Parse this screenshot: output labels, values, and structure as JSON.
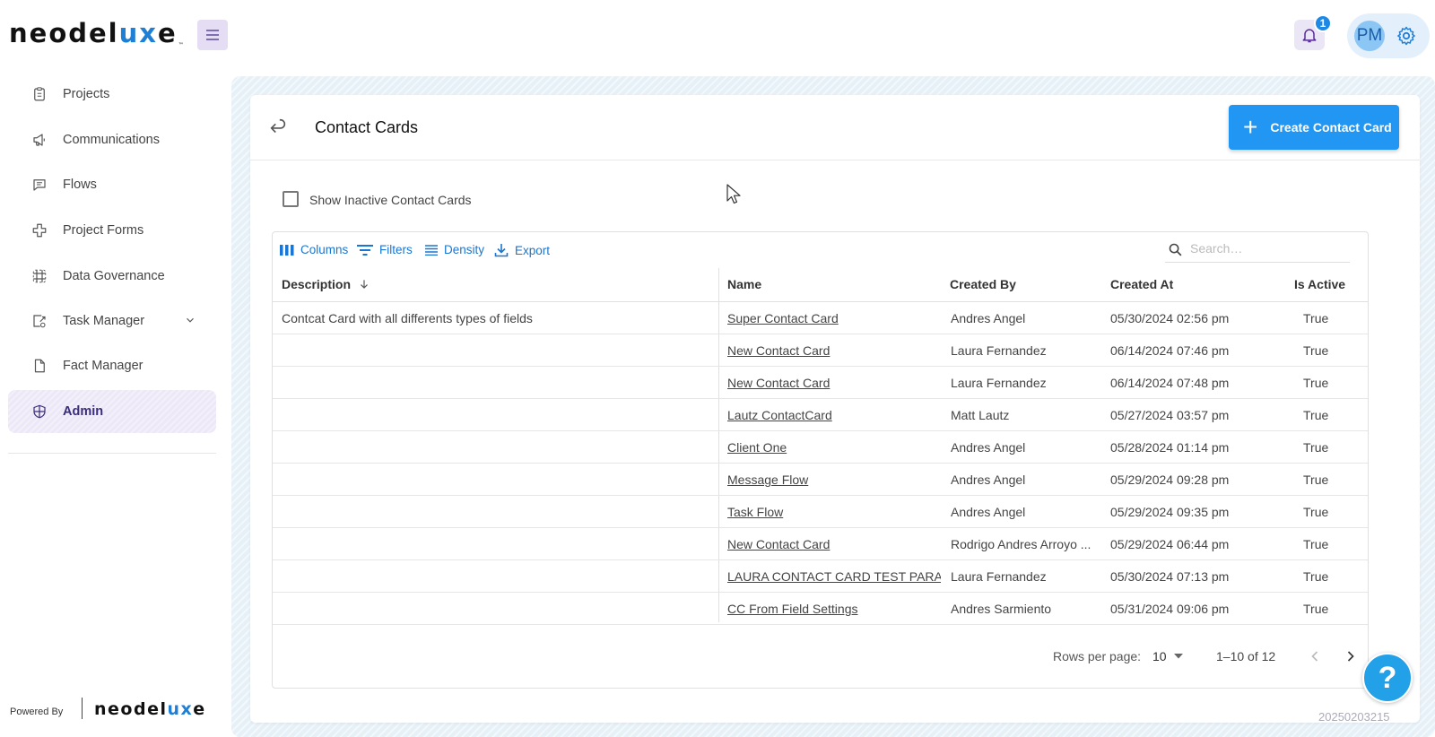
{
  "brand": {
    "logo_pre": "neodel",
    "logo_ux": "ux",
    "logo_post": "e",
    "tm": "™"
  },
  "header": {
    "notifications_count": "1",
    "avatar_initials": "PM"
  },
  "sidebar": {
    "items": [
      {
        "label": "Projects",
        "icon": "clipboard-icon"
      },
      {
        "label": "Communications",
        "icon": "megaphone-icon"
      },
      {
        "label": "Flows",
        "icon": "chat-icon"
      },
      {
        "label": "Project Forms",
        "icon": "forms-icon"
      },
      {
        "label": "Data Governance",
        "icon": "grid-icon"
      },
      {
        "label": "Task Manager",
        "icon": "task-icon"
      },
      {
        "label": "Fact Manager",
        "icon": "document-icon"
      },
      {
        "label": "Admin",
        "icon": "shield-icon",
        "active": true
      }
    ],
    "powered_by": "Powered By",
    "powered_logo_pre": "neodel",
    "powered_logo_ux": "ux",
    "powered_logo_post": "e"
  },
  "page": {
    "title": "Contact Cards",
    "create_label": "Create Contact Card",
    "show_inactive_label": "Show Inactive Contact Cards"
  },
  "toolbar": {
    "columns": "Columns",
    "filters": "Filters",
    "density": "Density",
    "export": "Export",
    "search_placeholder": "Search…"
  },
  "table": {
    "headers": [
      "Description",
      "Name",
      "Created By",
      "Created At",
      "Is Active"
    ],
    "rows": [
      [
        "Contcat Card with all differents types of fields",
        "Super Contact Card",
        "Andres Angel",
        "05/30/2024 02:56 pm",
        "True"
      ],
      [
        "",
        "New Contact Card",
        "Laura Fernandez",
        "06/14/2024 07:46 pm",
        "True"
      ],
      [
        "",
        "New Contact Card",
        "Laura Fernandez",
        "06/14/2024 07:48 pm",
        "True"
      ],
      [
        "",
        "Lautz ContactCard",
        "Matt Lautz",
        "05/27/2024 03:57 pm",
        "True"
      ],
      [
        "",
        "Client One",
        "Andres Angel",
        "05/28/2024 01:14 pm",
        "True"
      ],
      [
        "",
        "Message Flow",
        "Andres Angel",
        "05/29/2024 09:28 pm",
        "True"
      ],
      [
        "",
        "Task Flow",
        "Andres Angel",
        "05/29/2024 09:35 pm",
        "True"
      ],
      [
        "",
        "New Contact Card",
        "Rodrigo Andres Arroyo ...",
        "05/29/2024 06:44 pm",
        "True"
      ],
      [
        "",
        "LAURA CONTACT CARD TEST PARA AI",
        "Laura Fernandez",
        "05/30/2024 07:13 pm",
        "True"
      ],
      [
        "",
        "CC From Field Settings",
        "Andres Sarmiento",
        "05/31/2024 09:06 pm",
        "True"
      ]
    ]
  },
  "pagination": {
    "rows_per_page_label": "Rows per page:",
    "rows_per_page_value": "10",
    "range": "1–10 of 12"
  },
  "help": {
    "label": "?"
  },
  "stamp": "20250203215"
}
